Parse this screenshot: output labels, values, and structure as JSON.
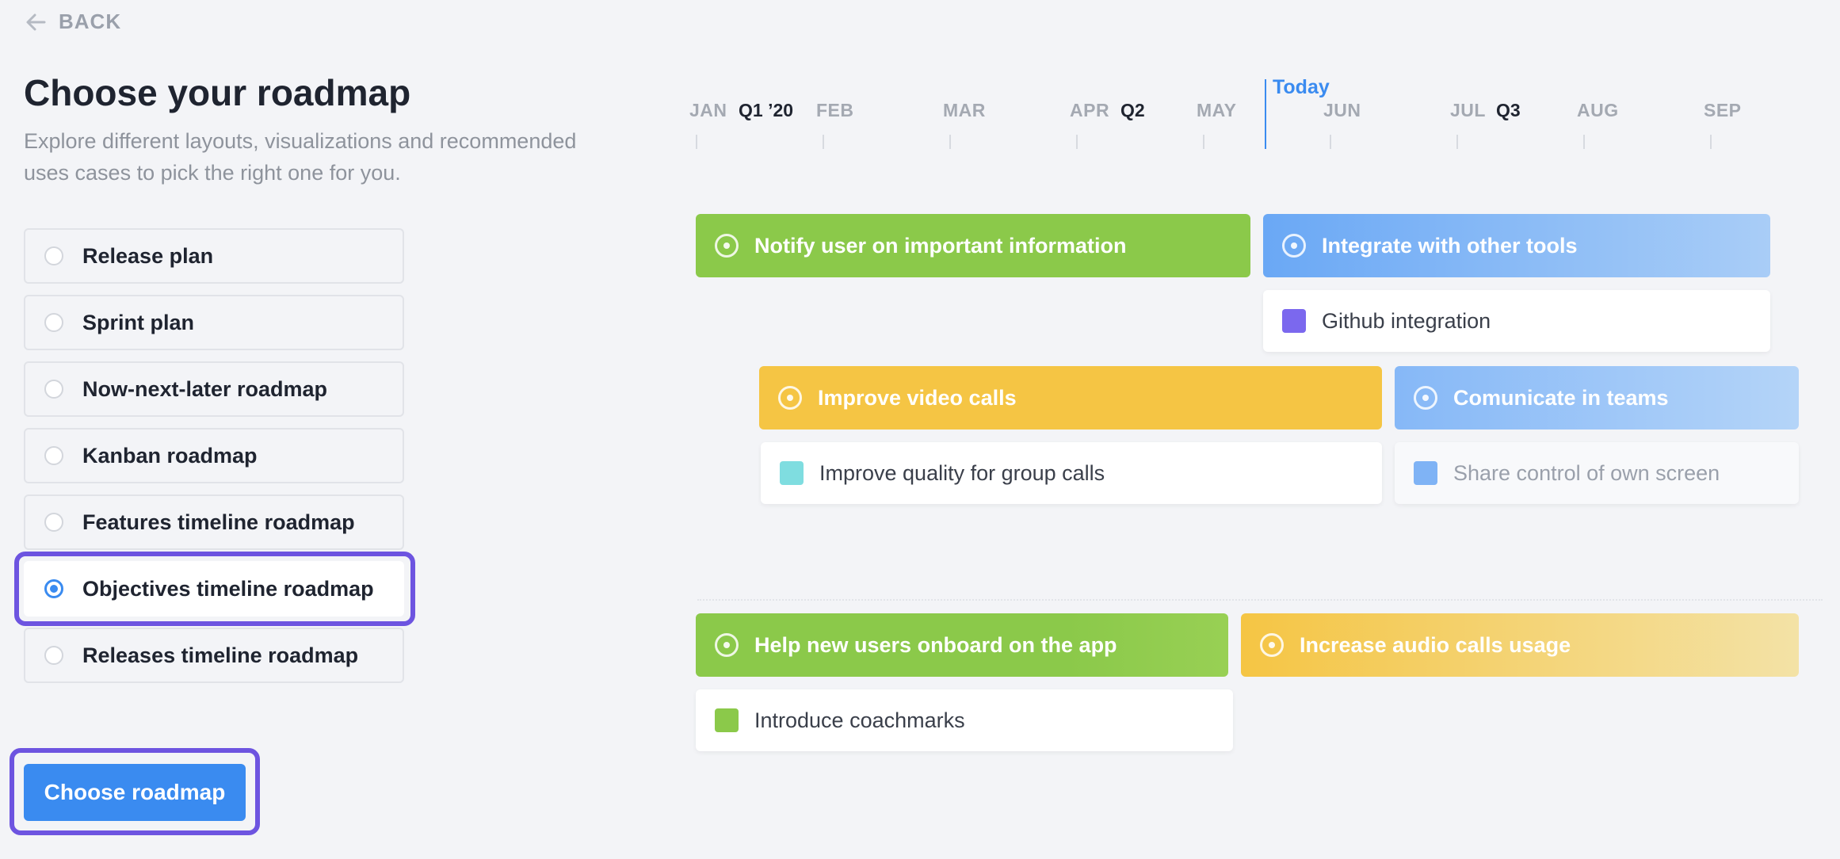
{
  "back": {
    "label": "BACK"
  },
  "page": {
    "title": "Choose your roadmap",
    "subtitle": "Explore different layouts, visualizations and recommended uses cases to pick the right one for you."
  },
  "options": [
    {
      "label": "Release plan",
      "selected": false
    },
    {
      "label": "Sprint plan",
      "selected": false
    },
    {
      "label": "Now-next-later roadmap",
      "selected": false
    },
    {
      "label": "Kanban roadmap",
      "selected": false
    },
    {
      "label": "Features timeline roadmap",
      "selected": false
    },
    {
      "label": "Objectives timeline roadmap",
      "selected": true
    },
    {
      "label": "Releases timeline roadmap",
      "selected": false
    }
  ],
  "choose_button": {
    "label": "Choose roadmap"
  },
  "timeline": {
    "months": [
      "JAN",
      "FEB",
      "MAR",
      "APR",
      "MAY",
      "JUN",
      "JUL",
      "AUG",
      "SEP"
    ],
    "quarters": [
      "Q1 ’20",
      "Q2",
      "Q3"
    ],
    "today_label": "Today"
  },
  "objectives": [
    {
      "label": "Notify user on important information",
      "color": "#8bc94a"
    },
    {
      "label": "Integrate with other tools",
      "color": "#6aa8f5"
    },
    {
      "label": "Improve video calls",
      "color": "#f5c544"
    },
    {
      "label": "Comunicate in teams",
      "color": "#86b8f7"
    },
    {
      "label": "Help new users onboard on the app",
      "color": "#8bc94a"
    },
    {
      "label": "Increase audio calls usage",
      "color": "#f5c544"
    }
  ],
  "key_results": [
    {
      "label": "Github integration",
      "color": "#7b68ee"
    },
    {
      "label": "Improve quality for group calls",
      "color": "#7fdde0"
    },
    {
      "label": "Share control of own screen",
      "color": "#7fb3f5"
    },
    {
      "label": "Introduce coachmarks",
      "color": "#8bc94a"
    }
  ],
  "icons": {
    "back": "arrow-left-icon",
    "objective": "target-icon",
    "key_result": "square-icon"
  },
  "colors": {
    "accent": "#3a8bf0",
    "highlight": "#6d54e0"
  }
}
